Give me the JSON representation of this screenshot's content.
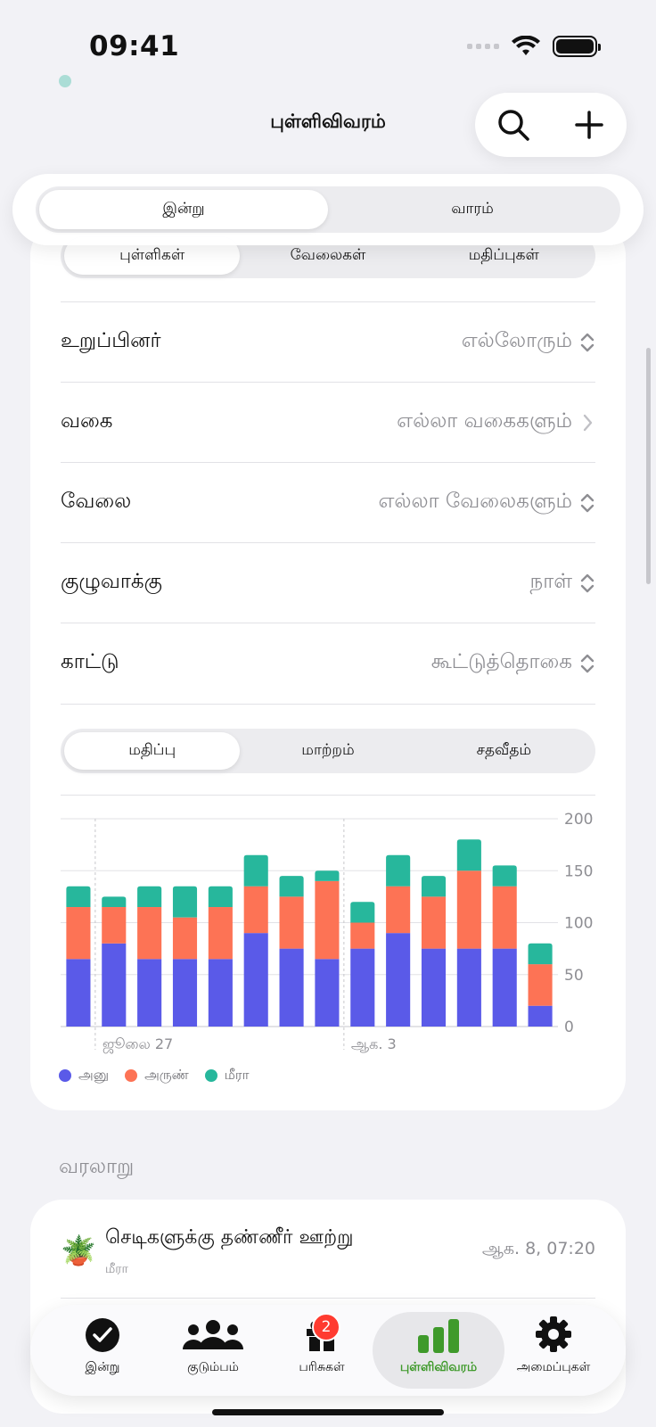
{
  "status": {
    "time": "09:41"
  },
  "nav": {
    "title": "புள்ளிவிவரம்"
  },
  "period_tabs": [
    "இன்று",
    "வாரம்"
  ],
  "metric_tabs": [
    "புள்ளிகள்",
    "வேலைகள்",
    "மதிப்புகள்"
  ],
  "filters": [
    {
      "label": "உறுப்பினர்",
      "value": "எல்லோரும்",
      "control": "updown"
    },
    {
      "label": "வகை",
      "value": "எல்லா வகைகளும்",
      "control": "chevron"
    },
    {
      "label": "வேலை",
      "value": "எல்லா வேலைகளும்",
      "control": "updown"
    },
    {
      "label": "குழுவாக்கு",
      "value": "நாள்",
      "control": "updown"
    },
    {
      "label": "காட்டு",
      "value": "கூட்டுத்தொகை",
      "control": "updown"
    }
  ],
  "view_tabs": [
    "மதிப்பு",
    "மாற்றம்",
    "சதவீதம்"
  ],
  "chart_data": {
    "type": "bar",
    "stacked": true,
    "categories": [
      "",
      "ஜூலை 27",
      "",
      "",
      "",
      "",
      "",
      "",
      "ஆக. 3",
      "",
      "",
      "",
      "",
      ""
    ],
    "x_tick_labels": [
      "ஜூலை 27",
      "ஆக. 3"
    ],
    "series": [
      {
        "name": "அனு",
        "color": "#5a5ae8",
        "values": [
          65,
          80,
          65,
          65,
          65,
          90,
          75,
          65,
          75,
          90,
          75,
          75,
          75,
          20
        ]
      },
      {
        "name": "அருண்",
        "color": "#fd7355",
        "values": [
          50,
          35,
          50,
          40,
          50,
          45,
          50,
          75,
          25,
          45,
          50,
          75,
          60,
          40
        ]
      },
      {
        "name": "மீரா",
        "color": "#27b79c",
        "values": [
          20,
          10,
          20,
          30,
          20,
          30,
          20,
          10,
          20,
          30,
          20,
          30,
          20,
          20
        ]
      }
    ],
    "ylim": [
      0,
      200
    ],
    "y_ticks": [
      0,
      50,
      100,
      150,
      200
    ],
    "grid": true,
    "legend": "bottom-left"
  },
  "history": {
    "title": "வரலாறு",
    "items": [
      {
        "icon": "🪴",
        "task": "செடிகளுக்கு தண்ணீர் ஊற்று",
        "user": "மீரா",
        "time": "ஆக. 8, 07:20"
      }
    ]
  },
  "tabbar": [
    {
      "label": "இன்று",
      "icon": "check-circle-icon"
    },
    {
      "label": "குடும்பம்",
      "icon": "people-icon"
    },
    {
      "label": "பரிசுகள்",
      "icon": "gift-icon",
      "badge": "2"
    },
    {
      "label": "புள்ளிவிவரம்",
      "icon": "chart-bar-icon",
      "active": true
    },
    {
      "label": "அமைப்புகள்",
      "icon": "gear-icon"
    }
  ],
  "colors": {
    "accent": "#3f9a2b",
    "badge": "#ff3b30"
  }
}
